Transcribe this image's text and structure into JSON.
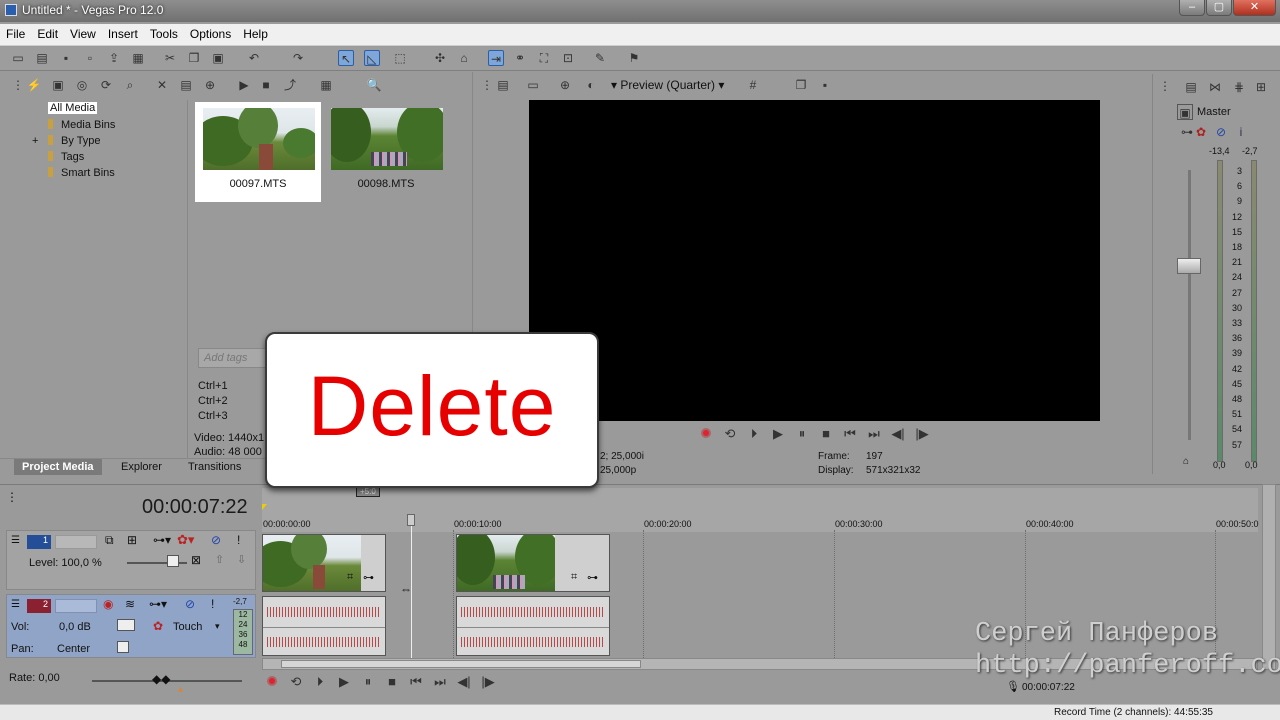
{
  "window": {
    "title": "Untitled * - Vegas Pro 12.0"
  },
  "menu": [
    "File",
    "Edit",
    "View",
    "Insert",
    "Tools",
    "Options",
    "Help"
  ],
  "explorer_tree": [
    {
      "label": "All Media",
      "selected": true
    },
    {
      "label": "Media Bins"
    },
    {
      "label": "By Type",
      "expandable": true
    },
    {
      "label": "Tags"
    },
    {
      "label": "Smart Bins"
    }
  ],
  "media": [
    {
      "name": "00097.MTS",
      "selected": true
    },
    {
      "name": "00098.MTS"
    }
  ],
  "tags": {
    "placeholder": "Add tags",
    "shortcuts": [
      "Ctrl+1",
      "Ctrl+2",
      "Ctrl+3"
    ]
  },
  "media_info": {
    "video": "Video: 1440x1",
    "audio": "Audio: 48 000"
  },
  "left_tabs": [
    "Project Media",
    "Explorer",
    "Transitions"
  ],
  "preview": {
    "mode": "Preview (Quarter)",
    "info_left1": "2; 25,000i",
    "info_left2": "25,000p",
    "frame_label": "Frame:",
    "frame_value": "197",
    "display_label": "Display:",
    "display_value": "571x321x32"
  },
  "overlay": {
    "text": "Delete"
  },
  "master": {
    "title": "Master",
    "peak_left": "-13,4",
    "peak_right": "-2,7",
    "scale": [
      "3",
      "6",
      "9",
      "12",
      "15",
      "18",
      "21",
      "24",
      "27",
      "30",
      "33",
      "36",
      "39",
      "42",
      "45",
      "48",
      "51",
      "54",
      "57"
    ],
    "bottom_left": "0,0",
    "bottom_right": "0,0"
  },
  "timeline": {
    "timecode": "00:00:07:22",
    "ruler": [
      "00:00:00:00",
      "00:00:10:00",
      "00:00:20:00",
      "00:00:30:00",
      "00:00:40:00",
      "00:00:50:0"
    ],
    "cursor_label": "+5:0",
    "video_track": {
      "number": "1",
      "level": "Level: 100,0 %"
    },
    "audio_track": {
      "number": "2",
      "vol_label": "Vol:",
      "vol_value": "0,0 dB",
      "pan_label": "Pan:",
      "pan_value": "Center",
      "mode": "Touch",
      "meter_peak": "-2,7",
      "meter_scale": [
        "12",
        "24",
        "36",
        "48"
      ]
    },
    "rate": "Rate: 0,00",
    "end_time": "00:00:07:22"
  },
  "watermark": {
    "line1": "Сергей Панферов",
    "line2": "http://panferoff.com"
  },
  "status": {
    "record_time": "Record Time (2 channels): 44:55:35"
  }
}
